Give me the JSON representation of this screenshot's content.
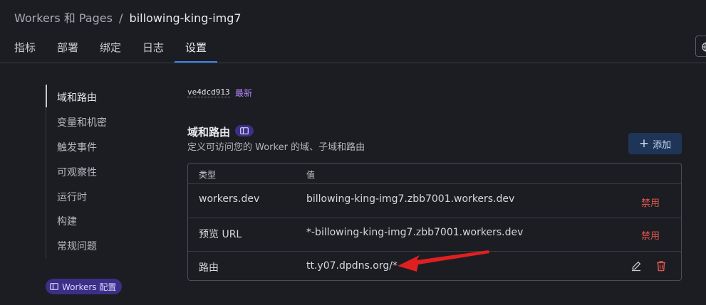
{
  "breadcrumb": {
    "parent": "Workers 和 Pages",
    "separator": "/",
    "current": "billowing-king-img7"
  },
  "tabs": [
    {
      "label": "指标"
    },
    {
      "label": "部署"
    },
    {
      "label": "绑定"
    },
    {
      "label": "日志"
    },
    {
      "label": "设置"
    }
  ],
  "active_tab": "设置",
  "sidebar": {
    "items": [
      {
        "label": "域和路由"
      },
      {
        "label": "变量和机密"
      },
      {
        "label": "触发事件"
      },
      {
        "label": "可观察性"
      },
      {
        "label": "运行时"
      },
      {
        "label": "构建"
      },
      {
        "label": "常规问题"
      }
    ],
    "badge": "Workers 配置"
  },
  "version": {
    "id": "ve4dcd913",
    "tag": "最新"
  },
  "domains_section": {
    "title": "域和路由",
    "description": "定义可访问您的 Worker 的域、子域和路由",
    "add_label": "添加"
  },
  "table": {
    "headers": {
      "type": "类型",
      "value": "值"
    },
    "rows": [
      {
        "type": "workers.dev",
        "value": "billowing-king-img7.zbb7001.workers.dev",
        "action": "禁用"
      },
      {
        "type": "预览 URL",
        "value": "*-billowing-king-img7.zbb7001.workers.dev",
        "action": "禁用"
      },
      {
        "type": "路由",
        "value": "tt.y07.dpdns.org/*"
      }
    ]
  },
  "icons": [
    "globe-icon",
    "book-icon",
    "plus-icon",
    "edit-icon",
    "trash-icon",
    "arrow-annotation"
  ],
  "colors": {
    "background": "#1c1d22",
    "accent": "#3d86ee",
    "badge": "#3c2f87",
    "latest": "#b585ff",
    "danger": "#e0564f",
    "annotation": "#e02020"
  }
}
